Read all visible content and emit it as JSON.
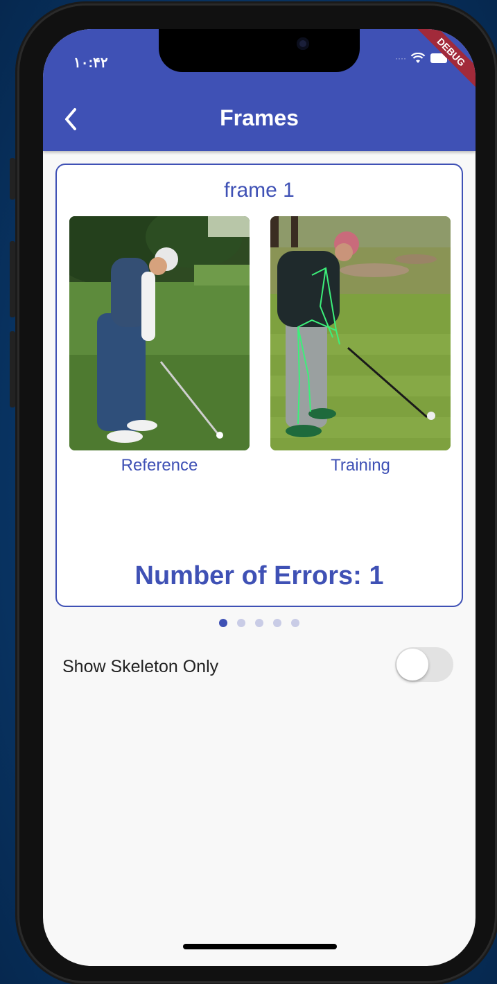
{
  "status_bar": {
    "time": "۱۰:۴۲",
    "debug_banner": "DEBUG"
  },
  "appbar": {
    "title": "Frames",
    "back_icon": "chevron-left-icon"
  },
  "card": {
    "frame_title": "frame 1",
    "reference_label": "Reference",
    "training_label": "Training",
    "errors_text": "Number of Errors: 1"
  },
  "pagination": {
    "total": 5,
    "active_index": 0
  },
  "skeleton_toggle": {
    "label": "Show Skeleton Only",
    "on": false
  },
  "colors": {
    "primary": "#3f51b5",
    "background": "#f8f8f8",
    "debug": "#a22a3a"
  }
}
